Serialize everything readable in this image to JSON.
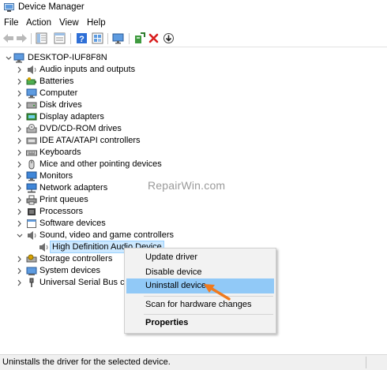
{
  "window": {
    "title": "Device Manager"
  },
  "menu": [
    "File",
    "Action",
    "View",
    "Help"
  ],
  "toolbar": {
    "buttons": [
      "back-icon",
      "forward-icon",
      "show-hide-tree-icon",
      "properties-icon",
      "help-icon",
      "view-icon",
      "monitor-scan-icon",
      "add-driver-icon",
      "uninstall-x-icon",
      "download-update-icon"
    ],
    "colors": {
      "uninstall_x": "#d81e1e",
      "help": "#2e6fd6"
    }
  },
  "tree": {
    "root": "DESKTOP-IUF8F8N",
    "categories": [
      {
        "label": "Audio inputs and outputs",
        "icon": "speaker-icon",
        "expanded": false
      },
      {
        "label": "Batteries",
        "icon": "battery-icon",
        "expanded": false
      },
      {
        "label": "Computer",
        "icon": "computer-icon",
        "expanded": false
      },
      {
        "label": "Disk drives",
        "icon": "disk-drive-icon",
        "expanded": false
      },
      {
        "label": "Display adapters",
        "icon": "display-adapter-icon",
        "expanded": false
      },
      {
        "label": "DVD/CD-ROM drives",
        "icon": "dvd-icon",
        "expanded": false
      },
      {
        "label": "IDE ATA/ATAPI controllers",
        "icon": "ide-controller-icon",
        "expanded": false
      },
      {
        "label": "Keyboards",
        "icon": "keyboard-icon",
        "expanded": false
      },
      {
        "label": "Mice and other pointing devices",
        "icon": "mouse-icon",
        "expanded": false
      },
      {
        "label": "Monitors",
        "icon": "monitor-icon",
        "expanded": false
      },
      {
        "label": "Network adapters",
        "icon": "network-adapter-icon",
        "expanded": false
      },
      {
        "label": "Print queues",
        "icon": "printer-icon",
        "expanded": false
      },
      {
        "label": "Processors",
        "icon": "processor-icon",
        "expanded": false
      },
      {
        "label": "Software devices",
        "icon": "software-device-icon",
        "expanded": false
      },
      {
        "label": "Sound, video and game controllers",
        "icon": "speaker-icon",
        "expanded": true,
        "children": [
          {
            "label": "High Definition Audio Device",
            "icon": "speaker-icon",
            "selected": true
          }
        ]
      },
      {
        "label": "Storage controllers",
        "icon": "storage-controller-icon",
        "expanded": false
      },
      {
        "label": "System devices",
        "icon": "system-device-icon",
        "expanded": false
      },
      {
        "label": "Universal Serial Bus cont",
        "icon": "usb-icon",
        "expanded": false
      }
    ]
  },
  "watermark": "RepairWin.com",
  "context_menu": {
    "items": [
      "Update driver",
      "Disable device",
      "Uninstall device",
      "Scan for hardware changes",
      "Properties"
    ],
    "highlighted": "Uninstall device",
    "bold": "Properties",
    "highlight_color": "#91c9f7"
  },
  "annotation": {
    "arrow_color": "#f07a1e"
  },
  "status": {
    "text": "Uninstalls the driver for the selected device."
  },
  "colors": {
    "selection_bg": "#cce8ff",
    "selection_border": "#99d1ff",
    "statusbar_bg": "#f0f0f0"
  }
}
